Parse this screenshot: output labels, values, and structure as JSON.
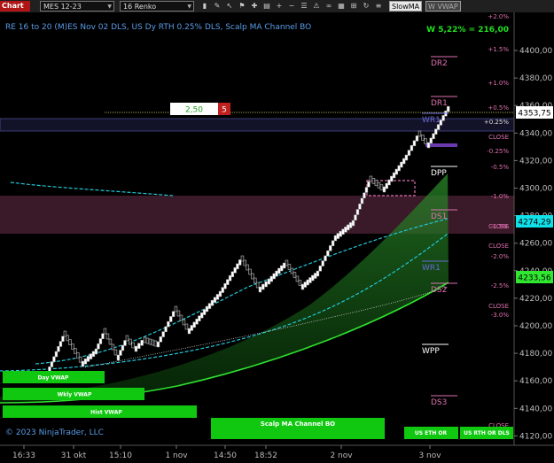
{
  "toolbar": {
    "chart_tab": "Chart",
    "instrument": "MES 12-23",
    "bar_type": "16 Renko",
    "slow_ma": "SlowMA",
    "w_vwap": "W VWAP"
  },
  "chart": {
    "title": "RE 16 to 20 (M)ES Nov 02 DLS, US Dy RTH 0.25% DLS, Scalp MA Channel BO",
    "pnl": "W 5,22% = 216,00",
    "copyright": "© 2023 NinjaTrader, LLC",
    "order_qty": "2,50",
    "order_count": "5",
    "price_badges": [
      "4353,75",
      "4274,29",
      "4233,56"
    ],
    "price_ticks": [
      "4400,00",
      "4380,00",
      "4360,00",
      "4340,00",
      "4320,00",
      "4300,00",
      "4280,00",
      "4260,00",
      "4240,00",
      "4220,00",
      "4200,00",
      "4180,00",
      "4160,00",
      "4140,00",
      "4120,00"
    ],
    "time_ticks": [
      "16:33",
      "31 okt",
      "15:10",
      "1 nov",
      "14:50",
      "18:52",
      "2 nov",
      "3 nov"
    ],
    "levels": [
      "DR2",
      "DR1",
      "WR1",
      "DPP",
      "DS1",
      "WR1",
      "DS2",
      "WPP",
      "DS3"
    ],
    "pct_labels": [
      "+2.0%",
      "+1.5%",
      "+1.0%",
      "+0.5%",
      "+0.25%",
      "CLOSE",
      "-0.25%",
      "-0.5%",
      "-1.0%",
      "-1.5%",
      "CLOSE",
      "CLOSE",
      "-2.0%",
      "-2.5%",
      "CLOSE",
      "-3.0%",
      "CLOSE"
    ],
    "tags": [
      "Day VWAP",
      "Wkly VWAP",
      "Hist VWAP",
      "Scalp MA Channel BO",
      "US ETH OR",
      "US RTH OR DLS"
    ],
    "colors": {
      "up": "#ffffff",
      "down": "#222222",
      "accent": "#00e000",
      "cyan": "#00d0e0"
    }
  }
}
